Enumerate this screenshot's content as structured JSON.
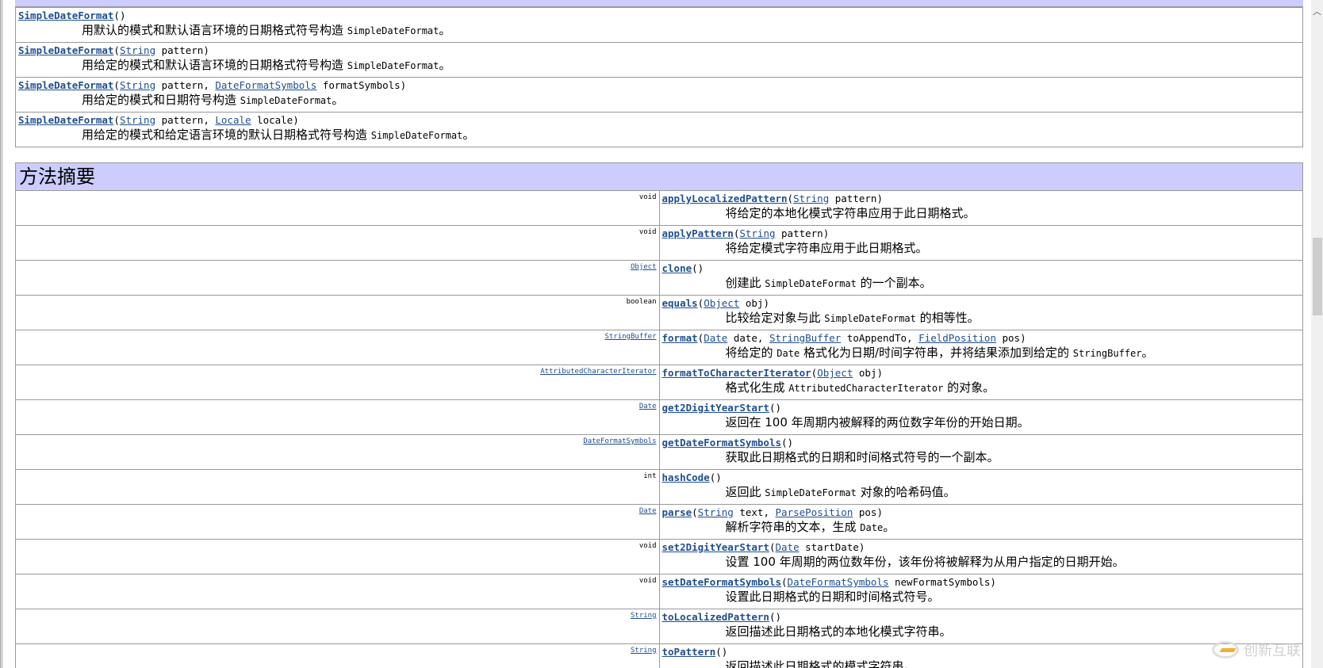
{
  "constructors": [
    {
      "name": "SimpleDateFormat",
      "params": [],
      "desc": [
        "用默认的模式和默认语言环境的日期格式符号构造 ",
        {
          "code": "SimpleDateFormat"
        },
        "。"
      ]
    },
    {
      "name": "SimpleDateFormat",
      "params": [
        {
          "t": "String",
          "link": true
        },
        {
          "t": " pattern"
        }
      ],
      "desc": [
        "用给定的模式和默认语言环境的日期格式符号构造 ",
        {
          "code": "SimpleDateFormat"
        },
        "。"
      ]
    },
    {
      "name": "SimpleDateFormat",
      "params": [
        {
          "t": "String",
          "link": true
        },
        {
          "t": " pattern, "
        },
        {
          "t": "DateFormatSymbols",
          "link": true
        },
        {
          "t": " formatSymbols"
        }
      ],
      "desc": [
        "用给定的模式和日期符号构造 ",
        {
          "code": "SimpleDateFormat"
        },
        "。"
      ]
    },
    {
      "name": "SimpleDateFormat",
      "params": [
        {
          "t": "String",
          "link": true
        },
        {
          "t": " pattern, "
        },
        {
          "t": "Locale",
          "link": true
        },
        {
          "t": " locale"
        }
      ],
      "desc": [
        "用给定的模式和给定语言环境的默认日期格式符号构造 ",
        {
          "code": "SimpleDateFormat"
        },
        "。"
      ]
    }
  ],
  "method_summary_title": "方法摘要",
  "methods": [
    {
      "type": "void",
      "type_link": false,
      "name": "applyLocalizedPattern",
      "params": [
        {
          "t": "String",
          "link": true
        },
        {
          "t": " pattern"
        }
      ],
      "desc": [
        "将给定的本地化模式字符串应用于此日期格式。"
      ]
    },
    {
      "type": "void",
      "type_link": false,
      "name": "applyPattern",
      "params": [
        {
          "t": "String",
          "link": true
        },
        {
          "t": " pattern"
        }
      ],
      "desc": [
        "将给定模式字符串应用于此日期格式。"
      ]
    },
    {
      "type": "Object",
      "type_link": true,
      "name": "clone",
      "params": [],
      "desc": [
        "创建此 ",
        {
          "code": "SimpleDateFormat"
        },
        " 的一个副本。"
      ]
    },
    {
      "type": "boolean",
      "type_link": false,
      "name": "equals",
      "params": [
        {
          "t": "Object",
          "link": true
        },
        {
          "t": " obj"
        }
      ],
      "desc": [
        "比较给定对象与此 ",
        {
          "code": "SimpleDateFormat"
        },
        " 的相等性。"
      ]
    },
    {
      "type": "StringBuffer",
      "type_link": true,
      "name": "format",
      "params": [
        {
          "t": "Date",
          "link": true
        },
        {
          "t": " date, "
        },
        {
          "t": "StringBuffer",
          "link": true
        },
        {
          "t": " toAppendTo, "
        },
        {
          "t": "FieldPosition",
          "link": true
        },
        {
          "t": " pos"
        }
      ],
      "desc": [
        "将给定的 ",
        {
          "code": "Date"
        },
        " 格式化为日期/时间字符串，并将结果添加到给定的 ",
        {
          "code": "StringBuffer"
        },
        "。"
      ]
    },
    {
      "type": "AttributedCharacterIterator",
      "type_link": true,
      "name": "formatToCharacterIterator",
      "params": [
        {
          "t": "Object",
          "link": true
        },
        {
          "t": " obj"
        }
      ],
      "desc": [
        "格式化生成 ",
        {
          "code": "AttributedCharacterIterator"
        },
        " 的对象。"
      ]
    },
    {
      "type": "Date",
      "type_link": true,
      "name": "get2DigitYearStart",
      "params": [],
      "desc": [
        "返回在 100 年周期内被解释的两位数字年份的开始日期。"
      ]
    },
    {
      "type": "DateFormatSymbols",
      "type_link": true,
      "name": "getDateFormatSymbols",
      "params": [],
      "desc": [
        "获取此日期格式的日期和时间格式符号的一个副本。"
      ]
    },
    {
      "type": "int",
      "type_link": false,
      "name": "hashCode",
      "params": [],
      "desc": [
        "返回此 ",
        {
          "code": "SimpleDateFormat"
        },
        " 对象的哈希码值。"
      ]
    },
    {
      "type": "Date",
      "type_link": true,
      "name": "parse",
      "params": [
        {
          "t": "String",
          "link": true
        },
        {
          "t": " text, "
        },
        {
          "t": "ParsePosition",
          "link": true
        },
        {
          "t": " pos"
        }
      ],
      "desc": [
        "解析字符串的文本，生成 ",
        {
          "code": "Date"
        },
        "。"
      ]
    },
    {
      "type": "void",
      "type_link": false,
      "name": "set2DigitYearStart",
      "params": [
        {
          "t": "Date",
          "link": true
        },
        {
          "t": " startDate"
        }
      ],
      "desc": [
        "设置 100 年周期的两位数年份，该年份将被解释为从用户指定的日期开始。"
      ]
    },
    {
      "type": "void",
      "type_link": false,
      "name": "setDateFormatSymbols",
      "params": [
        {
          "t": "DateFormatSymbols",
          "link": true
        },
        {
          "t": " newFormatSymbols"
        }
      ],
      "desc": [
        "设置此日期格式的日期和时间格式符号。"
      ]
    },
    {
      "type": "String",
      "type_link": true,
      "name": "toLocalizedPattern",
      "params": [],
      "desc": [
        "返回描述此日期格式的本地化模式字符串。"
      ]
    },
    {
      "type": "String",
      "type_link": true,
      "name": "toPattern",
      "params": [],
      "desc": [
        "返回描述此日期格式的模式字符串。"
      ]
    }
  ],
  "watermark": "创新互联"
}
